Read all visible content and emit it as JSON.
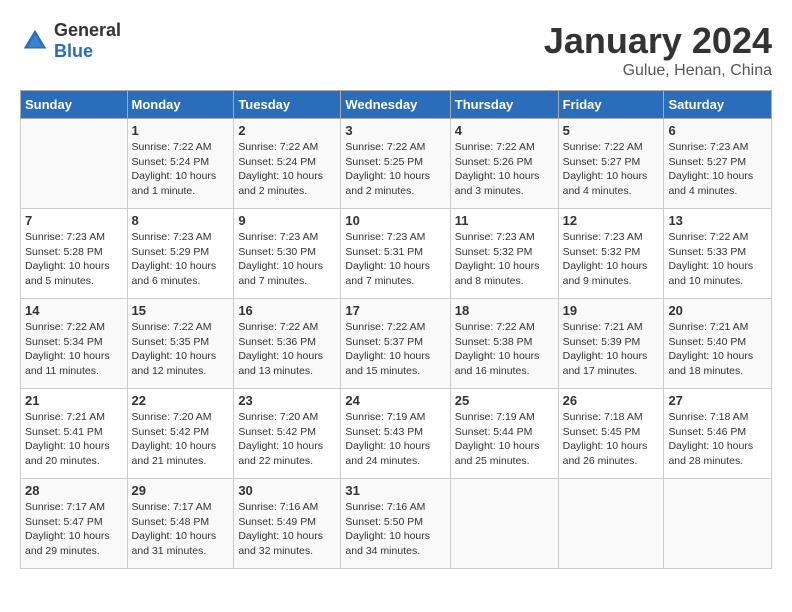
{
  "header": {
    "logo_general": "General",
    "logo_blue": "Blue",
    "month_title": "January 2024",
    "subtitle": "Gulue, Henan, China"
  },
  "weekdays": [
    "Sunday",
    "Monday",
    "Tuesday",
    "Wednesday",
    "Thursday",
    "Friday",
    "Saturday"
  ],
  "weeks": [
    [
      {
        "day": "",
        "sunrise": "",
        "sunset": "",
        "daylight": ""
      },
      {
        "day": "1",
        "sunrise": "Sunrise: 7:22 AM",
        "sunset": "Sunset: 5:24 PM",
        "daylight": "Daylight: 10 hours and 1 minute."
      },
      {
        "day": "2",
        "sunrise": "Sunrise: 7:22 AM",
        "sunset": "Sunset: 5:24 PM",
        "daylight": "Daylight: 10 hours and 2 minutes."
      },
      {
        "day": "3",
        "sunrise": "Sunrise: 7:22 AM",
        "sunset": "Sunset: 5:25 PM",
        "daylight": "Daylight: 10 hours and 2 minutes."
      },
      {
        "day": "4",
        "sunrise": "Sunrise: 7:22 AM",
        "sunset": "Sunset: 5:26 PM",
        "daylight": "Daylight: 10 hours and 3 minutes."
      },
      {
        "day": "5",
        "sunrise": "Sunrise: 7:22 AM",
        "sunset": "Sunset: 5:27 PM",
        "daylight": "Daylight: 10 hours and 4 minutes."
      },
      {
        "day": "6",
        "sunrise": "Sunrise: 7:23 AM",
        "sunset": "Sunset: 5:27 PM",
        "daylight": "Daylight: 10 hours and 4 minutes."
      }
    ],
    [
      {
        "day": "7",
        "sunrise": "Sunrise: 7:23 AM",
        "sunset": "Sunset: 5:28 PM",
        "daylight": "Daylight: 10 hours and 5 minutes."
      },
      {
        "day": "8",
        "sunrise": "Sunrise: 7:23 AM",
        "sunset": "Sunset: 5:29 PM",
        "daylight": "Daylight: 10 hours and 6 minutes."
      },
      {
        "day": "9",
        "sunrise": "Sunrise: 7:23 AM",
        "sunset": "Sunset: 5:30 PM",
        "daylight": "Daylight: 10 hours and 7 minutes."
      },
      {
        "day": "10",
        "sunrise": "Sunrise: 7:23 AM",
        "sunset": "Sunset: 5:31 PM",
        "daylight": "Daylight: 10 hours and 7 minutes."
      },
      {
        "day": "11",
        "sunrise": "Sunrise: 7:23 AM",
        "sunset": "Sunset: 5:32 PM",
        "daylight": "Daylight: 10 hours and 8 minutes."
      },
      {
        "day": "12",
        "sunrise": "Sunrise: 7:23 AM",
        "sunset": "Sunset: 5:32 PM",
        "daylight": "Daylight: 10 hours and 9 minutes."
      },
      {
        "day": "13",
        "sunrise": "Sunrise: 7:22 AM",
        "sunset": "Sunset: 5:33 PM",
        "daylight": "Daylight: 10 hours and 10 minutes."
      }
    ],
    [
      {
        "day": "14",
        "sunrise": "Sunrise: 7:22 AM",
        "sunset": "Sunset: 5:34 PM",
        "daylight": "Daylight: 10 hours and 11 minutes."
      },
      {
        "day": "15",
        "sunrise": "Sunrise: 7:22 AM",
        "sunset": "Sunset: 5:35 PM",
        "daylight": "Daylight: 10 hours and 12 minutes."
      },
      {
        "day": "16",
        "sunrise": "Sunrise: 7:22 AM",
        "sunset": "Sunset: 5:36 PM",
        "daylight": "Daylight: 10 hours and 13 minutes."
      },
      {
        "day": "17",
        "sunrise": "Sunrise: 7:22 AM",
        "sunset": "Sunset: 5:37 PM",
        "daylight": "Daylight: 10 hours and 15 minutes."
      },
      {
        "day": "18",
        "sunrise": "Sunrise: 7:22 AM",
        "sunset": "Sunset: 5:38 PM",
        "daylight": "Daylight: 10 hours and 16 minutes."
      },
      {
        "day": "19",
        "sunrise": "Sunrise: 7:21 AM",
        "sunset": "Sunset: 5:39 PM",
        "daylight": "Daylight: 10 hours and 17 minutes."
      },
      {
        "day": "20",
        "sunrise": "Sunrise: 7:21 AM",
        "sunset": "Sunset: 5:40 PM",
        "daylight": "Daylight: 10 hours and 18 minutes."
      }
    ],
    [
      {
        "day": "21",
        "sunrise": "Sunrise: 7:21 AM",
        "sunset": "Sunset: 5:41 PM",
        "daylight": "Daylight: 10 hours and 20 minutes."
      },
      {
        "day": "22",
        "sunrise": "Sunrise: 7:20 AM",
        "sunset": "Sunset: 5:42 PM",
        "daylight": "Daylight: 10 hours and 21 minutes."
      },
      {
        "day": "23",
        "sunrise": "Sunrise: 7:20 AM",
        "sunset": "Sunset: 5:42 PM",
        "daylight": "Daylight: 10 hours and 22 minutes."
      },
      {
        "day": "24",
        "sunrise": "Sunrise: 7:19 AM",
        "sunset": "Sunset: 5:43 PM",
        "daylight": "Daylight: 10 hours and 24 minutes."
      },
      {
        "day": "25",
        "sunrise": "Sunrise: 7:19 AM",
        "sunset": "Sunset: 5:44 PM",
        "daylight": "Daylight: 10 hours and 25 minutes."
      },
      {
        "day": "26",
        "sunrise": "Sunrise: 7:18 AM",
        "sunset": "Sunset: 5:45 PM",
        "daylight": "Daylight: 10 hours and 26 minutes."
      },
      {
        "day": "27",
        "sunrise": "Sunrise: 7:18 AM",
        "sunset": "Sunset: 5:46 PM",
        "daylight": "Daylight: 10 hours and 28 minutes."
      }
    ],
    [
      {
        "day": "28",
        "sunrise": "Sunrise: 7:17 AM",
        "sunset": "Sunset: 5:47 PM",
        "daylight": "Daylight: 10 hours and 29 minutes."
      },
      {
        "day": "29",
        "sunrise": "Sunrise: 7:17 AM",
        "sunset": "Sunset: 5:48 PM",
        "daylight": "Daylight: 10 hours and 31 minutes."
      },
      {
        "day": "30",
        "sunrise": "Sunrise: 7:16 AM",
        "sunset": "Sunset: 5:49 PM",
        "daylight": "Daylight: 10 hours and 32 minutes."
      },
      {
        "day": "31",
        "sunrise": "Sunrise: 7:16 AM",
        "sunset": "Sunset: 5:50 PM",
        "daylight": "Daylight: 10 hours and 34 minutes."
      },
      {
        "day": "",
        "sunrise": "",
        "sunset": "",
        "daylight": ""
      },
      {
        "day": "",
        "sunrise": "",
        "sunset": "",
        "daylight": ""
      },
      {
        "day": "",
        "sunrise": "",
        "sunset": "",
        "daylight": ""
      }
    ]
  ]
}
